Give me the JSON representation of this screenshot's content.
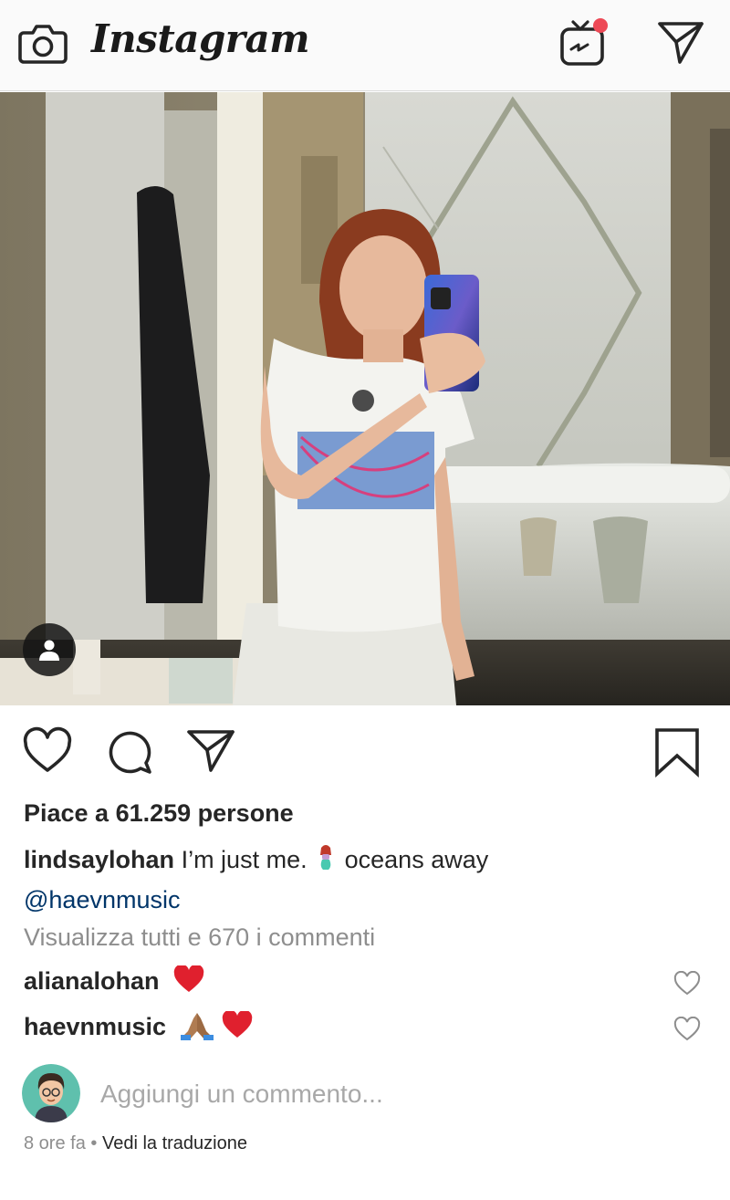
{
  "header": {
    "logo_text": "Instagram",
    "icons": [
      "camera-icon",
      "igtv-icon",
      "direct-message-icon"
    ],
    "igtv_badge_color": "#ed4956"
  },
  "post": {
    "image_alt": "Selfie in a bathroom mirror",
    "has_user_tags": true,
    "likes_text": "Piace a 61.259 persone",
    "caption": {
      "username": "lindsaylohan",
      "text_before_emoji": "I’m just me.",
      "emoji": "mermaid-emoji",
      "text_after_emoji": "oceans away",
      "mention": "@haevnmusic"
    },
    "view_all_comments": "Visualizza tutti e 670 i commenti",
    "comments": [
      {
        "username": "alianalohan",
        "emojis": [
          "red-heart-emoji"
        ]
      },
      {
        "username": "haevnmusic",
        "emojis": [
          "folded-hands-emoji",
          "red-heart-emoji"
        ]
      }
    ],
    "add_comment_placeholder": "Aggiungi un commento...",
    "time_ago": "8 ore fa",
    "separator": "•",
    "see_translation": "Vedi la traduzione"
  },
  "colors": {
    "text": "#262626",
    "muted": "#8e8e8e",
    "mention": "#003569",
    "heart_red": "#e0202e"
  }
}
